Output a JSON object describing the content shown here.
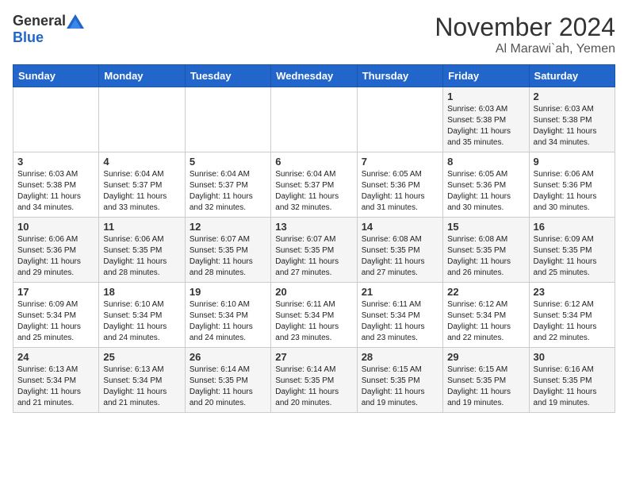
{
  "header": {
    "logo_general": "General",
    "logo_blue": "Blue",
    "month_title": "November 2024",
    "location": "Al Marawi`ah, Yemen"
  },
  "weekdays": [
    "Sunday",
    "Monday",
    "Tuesday",
    "Wednesday",
    "Thursday",
    "Friday",
    "Saturday"
  ],
  "weeks": [
    [
      {
        "day": "",
        "info": ""
      },
      {
        "day": "",
        "info": ""
      },
      {
        "day": "",
        "info": ""
      },
      {
        "day": "",
        "info": ""
      },
      {
        "day": "",
        "info": ""
      },
      {
        "day": "1",
        "info": "Sunrise: 6:03 AM\nSunset: 5:38 PM\nDaylight: 11 hours\nand 35 minutes."
      },
      {
        "day": "2",
        "info": "Sunrise: 6:03 AM\nSunset: 5:38 PM\nDaylight: 11 hours\nand 34 minutes."
      }
    ],
    [
      {
        "day": "3",
        "info": "Sunrise: 6:03 AM\nSunset: 5:38 PM\nDaylight: 11 hours\nand 34 minutes."
      },
      {
        "day": "4",
        "info": "Sunrise: 6:04 AM\nSunset: 5:37 PM\nDaylight: 11 hours\nand 33 minutes."
      },
      {
        "day": "5",
        "info": "Sunrise: 6:04 AM\nSunset: 5:37 PM\nDaylight: 11 hours\nand 32 minutes."
      },
      {
        "day": "6",
        "info": "Sunrise: 6:04 AM\nSunset: 5:37 PM\nDaylight: 11 hours\nand 32 minutes."
      },
      {
        "day": "7",
        "info": "Sunrise: 6:05 AM\nSunset: 5:36 PM\nDaylight: 11 hours\nand 31 minutes."
      },
      {
        "day": "8",
        "info": "Sunrise: 6:05 AM\nSunset: 5:36 PM\nDaylight: 11 hours\nand 30 minutes."
      },
      {
        "day": "9",
        "info": "Sunrise: 6:06 AM\nSunset: 5:36 PM\nDaylight: 11 hours\nand 30 minutes."
      }
    ],
    [
      {
        "day": "10",
        "info": "Sunrise: 6:06 AM\nSunset: 5:36 PM\nDaylight: 11 hours\nand 29 minutes."
      },
      {
        "day": "11",
        "info": "Sunrise: 6:06 AM\nSunset: 5:35 PM\nDaylight: 11 hours\nand 28 minutes."
      },
      {
        "day": "12",
        "info": "Sunrise: 6:07 AM\nSunset: 5:35 PM\nDaylight: 11 hours\nand 28 minutes."
      },
      {
        "day": "13",
        "info": "Sunrise: 6:07 AM\nSunset: 5:35 PM\nDaylight: 11 hours\nand 27 minutes."
      },
      {
        "day": "14",
        "info": "Sunrise: 6:08 AM\nSunset: 5:35 PM\nDaylight: 11 hours\nand 27 minutes."
      },
      {
        "day": "15",
        "info": "Sunrise: 6:08 AM\nSunset: 5:35 PM\nDaylight: 11 hours\nand 26 minutes."
      },
      {
        "day": "16",
        "info": "Sunrise: 6:09 AM\nSunset: 5:35 PM\nDaylight: 11 hours\nand 25 minutes."
      }
    ],
    [
      {
        "day": "17",
        "info": "Sunrise: 6:09 AM\nSunset: 5:34 PM\nDaylight: 11 hours\nand 25 minutes."
      },
      {
        "day": "18",
        "info": "Sunrise: 6:10 AM\nSunset: 5:34 PM\nDaylight: 11 hours\nand 24 minutes."
      },
      {
        "day": "19",
        "info": "Sunrise: 6:10 AM\nSunset: 5:34 PM\nDaylight: 11 hours\nand 24 minutes."
      },
      {
        "day": "20",
        "info": "Sunrise: 6:11 AM\nSunset: 5:34 PM\nDaylight: 11 hours\nand 23 minutes."
      },
      {
        "day": "21",
        "info": "Sunrise: 6:11 AM\nSunset: 5:34 PM\nDaylight: 11 hours\nand 23 minutes."
      },
      {
        "day": "22",
        "info": "Sunrise: 6:12 AM\nSunset: 5:34 PM\nDaylight: 11 hours\nand 22 minutes."
      },
      {
        "day": "23",
        "info": "Sunrise: 6:12 AM\nSunset: 5:34 PM\nDaylight: 11 hours\nand 22 minutes."
      }
    ],
    [
      {
        "day": "24",
        "info": "Sunrise: 6:13 AM\nSunset: 5:34 PM\nDaylight: 11 hours\nand 21 minutes."
      },
      {
        "day": "25",
        "info": "Sunrise: 6:13 AM\nSunset: 5:34 PM\nDaylight: 11 hours\nand 21 minutes."
      },
      {
        "day": "26",
        "info": "Sunrise: 6:14 AM\nSunset: 5:35 PM\nDaylight: 11 hours\nand 20 minutes."
      },
      {
        "day": "27",
        "info": "Sunrise: 6:14 AM\nSunset: 5:35 PM\nDaylight: 11 hours\nand 20 minutes."
      },
      {
        "day": "28",
        "info": "Sunrise: 6:15 AM\nSunset: 5:35 PM\nDaylight: 11 hours\nand 19 minutes."
      },
      {
        "day": "29",
        "info": "Sunrise: 6:15 AM\nSunset: 5:35 PM\nDaylight: 11 hours\nand 19 minutes."
      },
      {
        "day": "30",
        "info": "Sunrise: 6:16 AM\nSunset: 5:35 PM\nDaylight: 11 hours\nand 19 minutes."
      }
    ]
  ]
}
